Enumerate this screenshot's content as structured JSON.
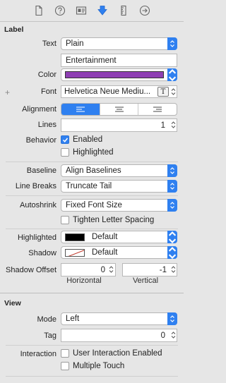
{
  "toolbar": {
    "icons": [
      "file-icon",
      "help-icon",
      "identity-icon",
      "attributes-icon",
      "size-ruler-icon",
      "connections-arrow-icon"
    ]
  },
  "label_section": {
    "title": "Label",
    "text_label": "Text",
    "text_value": "Plain",
    "text_content": "Entertainment",
    "color_label": "Color",
    "color_value": "#8e3fb3",
    "plus": "+",
    "font_label": "Font",
    "font_value": "Helvetica Neue Mediu...",
    "font_button": "T",
    "alignment_label": "Alignment",
    "alignment_selected": "left",
    "lines_label": "Lines",
    "lines_value": "1",
    "behavior_label": "Behavior",
    "enabled_label": "Enabled",
    "highlighted_check_label": "Highlighted",
    "baseline_label": "Baseline",
    "baseline_value": "Align Baselines",
    "linebreaks_label": "Line Breaks",
    "linebreaks_value": "Truncate Tail",
    "autoshrink_label": "Autoshrink",
    "autoshrink_value": "Fixed Font Size",
    "tighten_label": "Tighten Letter Spacing",
    "highlighted_label": "Highlighted",
    "highlighted_value": "Default",
    "shadow_label": "Shadow",
    "shadow_value": "Default",
    "shadow_offset_label": "Shadow Offset",
    "shadow_h_value": "0",
    "shadow_v_value": "-1",
    "horizontal_caption": "Horizontal",
    "vertical_caption": "Vertical"
  },
  "view_section": {
    "title": "View",
    "mode_label": "Mode",
    "mode_value": "Left",
    "tag_label": "Tag",
    "tag_value": "0",
    "interaction_label": "Interaction",
    "user_interaction_label": "User Interaction Enabled",
    "multiple_touch_label": "Multiple Touch"
  },
  "colors": {
    "accent": "#2f80f0",
    "label_color": "#8e3fb3"
  }
}
